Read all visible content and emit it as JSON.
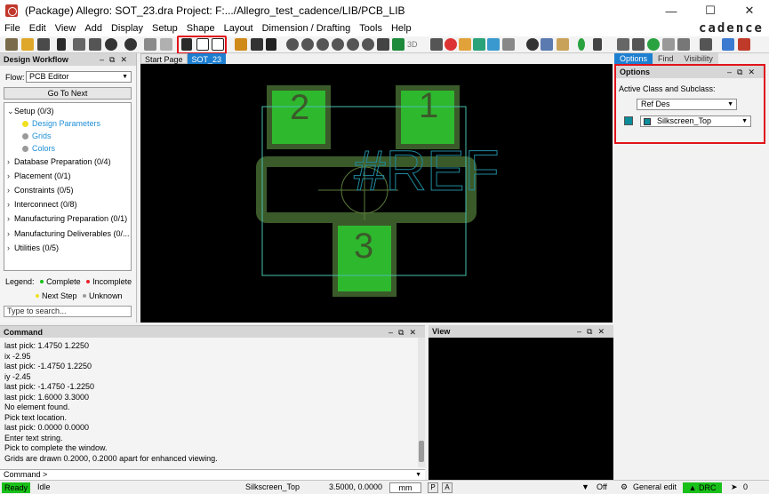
{
  "window": {
    "title": "(Package) Allegro: SOT_23.dra  Project: F:.../Allegro_test_cadence/LIB/PCB_LIB",
    "minimize": "—",
    "maximize": "☐",
    "close": "✕"
  },
  "menu": {
    "items": [
      "File",
      "Edit",
      "View",
      "Add",
      "Display",
      "Setup",
      "Shape",
      "Layout",
      "Dimension / Drafting",
      "Tools",
      "Help"
    ],
    "brand": "cadence"
  },
  "design_workflow": {
    "title": "Design Workflow",
    "flow_label": "Flow:",
    "flow_value": "PCB Editor",
    "goto_next": "Go To Next",
    "setup": "Setup  (0/3)",
    "setup_items": [
      {
        "label": "Design Parameters",
        "color": "#f0e020"
      },
      {
        "label": "Grids",
        "color": "#9a9a9a"
      },
      {
        "label": "Colors",
        "color": "#9a9a9a"
      }
    ],
    "groups": [
      "Database Preparation  (0/4)",
      "Placement  (0/1)",
      "Constraints  (0/5)",
      "Interconnect  (0/8)",
      "Manufacturing Preparation  (0/1)",
      "Manufacturing Deliverables  (0/...",
      "Utilities  (0/5)"
    ],
    "legend_label": "Legend:",
    "legend": [
      {
        "label": "Complete",
        "color": "#19c019"
      },
      {
        "label": "Incomplete",
        "color": "#e8202a"
      },
      {
        "label": "Next Step",
        "color": "#f0e020"
      },
      {
        "label": "Unknown",
        "color": "#9a9a9a"
      }
    ],
    "search_placeholder": "Type to search..."
  },
  "tabs": [
    "Start Page",
    "SOT_23"
  ],
  "canvas": {
    "pad_labels": [
      "2",
      "1",
      "3"
    ],
    "refdes": "#REF"
  },
  "options": {
    "tabs": [
      "Options",
      "Find",
      "Visibility"
    ],
    "title": "Options",
    "class_label": "Active Class and Subclass:",
    "class_value": "Ref Des",
    "subclass_value": "Silkscreen_Top"
  },
  "command": {
    "title": "Command",
    "log": [
      "last pick:  1.4750 1.2250",
      "ix -2.95",
      "last pick:  -1.4750 1.2250",
      "iy -2.45",
      "last pick:  -1.4750 -1.2250",
      "last pick:  1.6000 3.3000",
      "No element found.",
      "Pick text location.",
      "last pick:  0.0000 0.0000",
      "Enter text string.",
      "Pick to complete the window.",
      "Grids are drawn 0.2000, 0.2000 apart for enhanced viewing."
    ],
    "prompt": "Command >"
  },
  "view": {
    "title": "View"
  },
  "status": {
    "ready": "Ready",
    "mode": "Idle",
    "subclass": "Silkscreen_Top",
    "coords": "3.5000, 0.0000",
    "units": "mm",
    "p": "P",
    "a": "A",
    "filter": "Off",
    "edit_mode": "General edit",
    "drc": "DRC",
    "count": "0"
  },
  "colors": {
    "pad_fill": "#2eb82e",
    "pad_border": "#3b5a2a",
    "assembly_line": "#49bfae",
    "refdes_text": "#1f8a9e",
    "accent_blue": "#1e7fd0",
    "highlight_red": "#e1131b"
  }
}
